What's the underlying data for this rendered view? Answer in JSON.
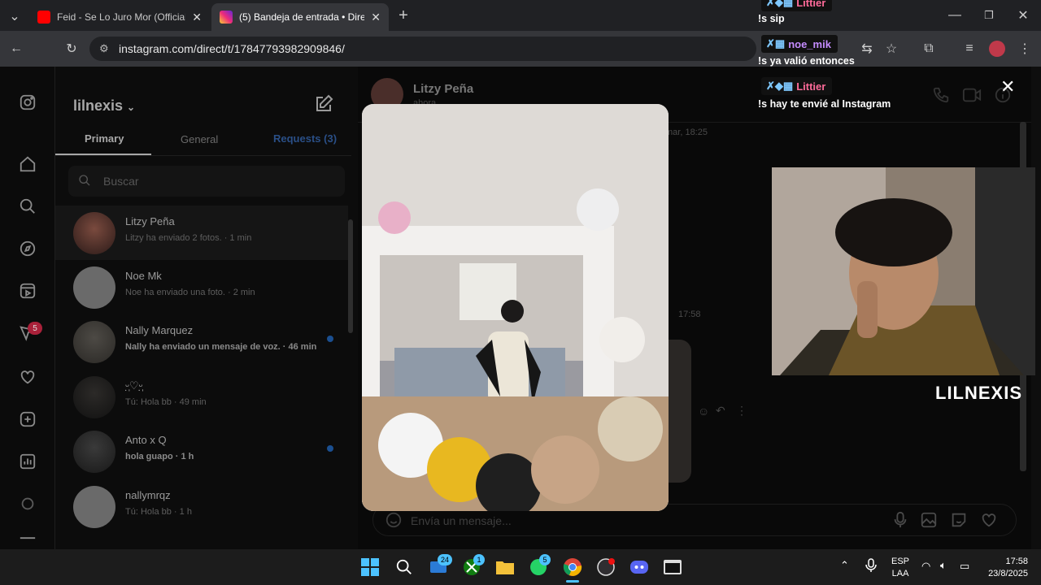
{
  "browser": {
    "tabs": [
      {
        "title": "Feid - Se Lo Juro Mor (Official V",
        "favicon": "youtube-icon",
        "active": false
      },
      {
        "title": "(5) Bandeja de entrada • Direct",
        "favicon": "instagram-icon",
        "active": true
      }
    ],
    "url": "instagram.com/direct/t/17847793982909846/"
  },
  "sidebar": {
    "notification_count": "5"
  },
  "inbox": {
    "username": "lilnexis",
    "tabs": [
      "Primary",
      "General",
      "Requests (3)"
    ],
    "search_placeholder": "Buscar",
    "conversations": [
      {
        "name": "Litzy Peña",
        "preview": "Litzy ha enviado 2 fotos. · 1 min",
        "unread": false
      },
      {
        "name": "Noe Mk",
        "preview": "Noe ha enviado una foto. · 2 min",
        "unread": false
      },
      {
        "name": "Nally Marquez",
        "preview": "Nally ha enviado un mensaje de voz. · 46 min",
        "unread": true
      },
      {
        "name": "ᵕ̣̣̩♡ᵕ̣̣̩",
        "preview": "Tú: Hola bb · 49 min",
        "unread": false
      },
      {
        "name": "Anto x Q",
        "preview": "hola guapo · 1 h",
        "unread": true
      },
      {
        "name": "nallymrqz",
        "preview": "Tú: Hola bb · 1 h",
        "unread": false
      }
    ]
  },
  "thread": {
    "contact_name": "Litzy Peña",
    "contact_status": "ahora",
    "timestamp_1": "mar, 18:25",
    "timestamp_2": "17:58",
    "message_placeholder": "Envía un mensaje..."
  },
  "stream_chat": [
    {
      "user": "Littier",
      "message": "!s sip",
      "color": "#ff6b9a"
    },
    {
      "user": "noe_mik",
      "message": "!s ya valió entonces",
      "color": "#c58cff"
    },
    {
      "user": "Littier",
      "message": "!s hay te envié al Instagram",
      "color": "#ff6b9a"
    }
  ],
  "streamer_label": "LILNEXIS",
  "taskbar": {
    "language": "ESP",
    "layout": "LAA",
    "time": "17:58",
    "date": "23/8/2025",
    "mail_badge": "24",
    "xbox_badge": "1",
    "whatsapp_badge": "5"
  }
}
